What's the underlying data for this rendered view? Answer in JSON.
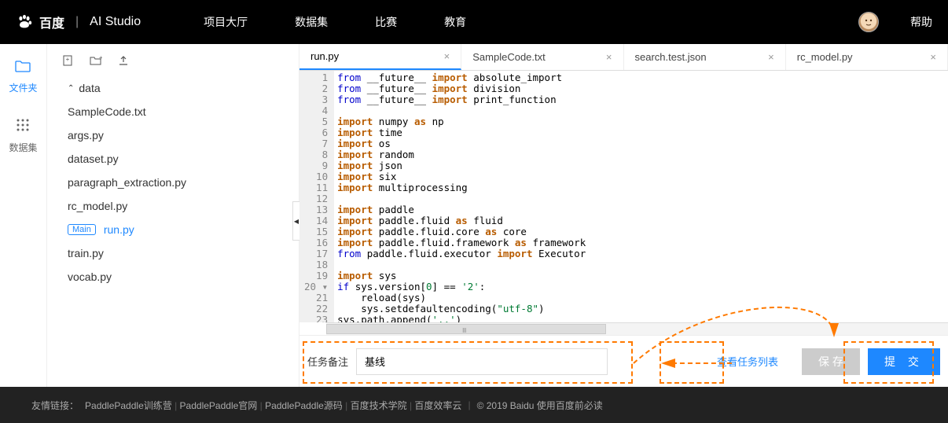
{
  "header": {
    "brand_baidu": "百度",
    "brand_studio": "AI Studio",
    "nav": [
      "项目大厅",
      "数据集",
      "比赛",
      "教育"
    ],
    "help": "帮助"
  },
  "rail": {
    "files_label": "文件夹",
    "datasets_label": "数据集"
  },
  "sidebar": {
    "folder": "data",
    "files": [
      "SampleCode.txt",
      "args.py",
      "dataset.py",
      "paragraph_extraction.py",
      "rc_model.py",
      "run.py",
      "train.py",
      "vocab.py"
    ],
    "main_badge": "Main",
    "active_index": 5
  },
  "tabs": [
    {
      "label": "run.py",
      "active": true
    },
    {
      "label": "SampleCode.txt",
      "active": false
    },
    {
      "label": "search.test.json",
      "active": false
    },
    {
      "label": "rc_model.py",
      "active": false
    }
  ],
  "code": {
    "lines": [
      [
        {
          "t": "kw",
          "v": "from"
        },
        {
          "t": "sp",
          "v": " "
        },
        {
          "t": "mod",
          "v": "__future__"
        },
        {
          "t": "sp",
          "v": " "
        },
        {
          "t": "op",
          "v": "import"
        },
        {
          "t": "sp",
          "v": " "
        },
        {
          "t": "id",
          "v": "absolute_import"
        }
      ],
      [
        {
          "t": "kw",
          "v": "from"
        },
        {
          "t": "sp",
          "v": " "
        },
        {
          "t": "mod",
          "v": "__future__"
        },
        {
          "t": "sp",
          "v": " "
        },
        {
          "t": "op",
          "v": "import"
        },
        {
          "t": "sp",
          "v": " "
        },
        {
          "t": "id",
          "v": "division"
        }
      ],
      [
        {
          "t": "kw",
          "v": "from"
        },
        {
          "t": "sp",
          "v": " "
        },
        {
          "t": "mod",
          "v": "__future__"
        },
        {
          "t": "sp",
          "v": " "
        },
        {
          "t": "op",
          "v": "import"
        },
        {
          "t": "sp",
          "v": " "
        },
        {
          "t": "id",
          "v": "print_function"
        }
      ],
      [],
      [
        {
          "t": "op",
          "v": "import"
        },
        {
          "t": "sp",
          "v": " "
        },
        {
          "t": "id",
          "v": "numpy"
        },
        {
          "t": "sp",
          "v": " "
        },
        {
          "t": "op",
          "v": "as"
        },
        {
          "t": "sp",
          "v": " "
        },
        {
          "t": "id",
          "v": "np"
        }
      ],
      [
        {
          "t": "op",
          "v": "import"
        },
        {
          "t": "sp",
          "v": " "
        },
        {
          "t": "id",
          "v": "time"
        }
      ],
      [
        {
          "t": "op",
          "v": "import"
        },
        {
          "t": "sp",
          "v": " "
        },
        {
          "t": "id",
          "v": "os"
        }
      ],
      [
        {
          "t": "op",
          "v": "import"
        },
        {
          "t": "sp",
          "v": " "
        },
        {
          "t": "id",
          "v": "random"
        }
      ],
      [
        {
          "t": "op",
          "v": "import"
        },
        {
          "t": "sp",
          "v": " "
        },
        {
          "t": "id",
          "v": "json"
        }
      ],
      [
        {
          "t": "op",
          "v": "import"
        },
        {
          "t": "sp",
          "v": " "
        },
        {
          "t": "id",
          "v": "six"
        }
      ],
      [
        {
          "t": "op",
          "v": "import"
        },
        {
          "t": "sp",
          "v": " "
        },
        {
          "t": "id",
          "v": "multiprocessing"
        }
      ],
      [],
      [
        {
          "t": "op",
          "v": "import"
        },
        {
          "t": "sp",
          "v": " "
        },
        {
          "t": "id",
          "v": "paddle"
        }
      ],
      [
        {
          "t": "op",
          "v": "import"
        },
        {
          "t": "sp",
          "v": " "
        },
        {
          "t": "id",
          "v": "paddle.fluid"
        },
        {
          "t": "sp",
          "v": " "
        },
        {
          "t": "op",
          "v": "as"
        },
        {
          "t": "sp",
          "v": " "
        },
        {
          "t": "id",
          "v": "fluid"
        }
      ],
      [
        {
          "t": "op",
          "v": "import"
        },
        {
          "t": "sp",
          "v": " "
        },
        {
          "t": "id",
          "v": "paddle.fluid.core"
        },
        {
          "t": "sp",
          "v": " "
        },
        {
          "t": "op",
          "v": "as"
        },
        {
          "t": "sp",
          "v": " "
        },
        {
          "t": "id",
          "v": "core"
        }
      ],
      [
        {
          "t": "op",
          "v": "import"
        },
        {
          "t": "sp",
          "v": " "
        },
        {
          "t": "id",
          "v": "paddle.fluid.framework"
        },
        {
          "t": "sp",
          "v": " "
        },
        {
          "t": "op",
          "v": "as"
        },
        {
          "t": "sp",
          "v": " "
        },
        {
          "t": "id",
          "v": "framework"
        }
      ],
      [
        {
          "t": "kw",
          "v": "from"
        },
        {
          "t": "sp",
          "v": " "
        },
        {
          "t": "mod",
          "v": "paddle.fluid.executor"
        },
        {
          "t": "sp",
          "v": " "
        },
        {
          "t": "op",
          "v": "import"
        },
        {
          "t": "sp",
          "v": " "
        },
        {
          "t": "id",
          "v": "Executor"
        }
      ],
      [],
      [
        {
          "t": "op",
          "v": "import"
        },
        {
          "t": "sp",
          "v": " "
        },
        {
          "t": "id",
          "v": "sys"
        }
      ],
      [
        {
          "t": "kw",
          "v": "if"
        },
        {
          "t": "sp",
          "v": " "
        },
        {
          "t": "id",
          "v": "sys.version["
        },
        {
          "t": "num",
          "v": "0"
        },
        {
          "t": "id",
          "v": "]"
        },
        {
          "t": "sp",
          "v": " "
        },
        {
          "t": "id",
          "v": "=="
        },
        {
          "t": "sp",
          "v": " "
        },
        {
          "t": "str",
          "v": "'2'"
        },
        {
          "t": "id",
          "v": ":"
        }
      ],
      [
        {
          "t": "sp",
          "v": "    "
        },
        {
          "t": "id",
          "v": "reload(sys)"
        }
      ],
      [
        {
          "t": "sp",
          "v": "    "
        },
        {
          "t": "id",
          "v": "sys.setdefaultencoding("
        },
        {
          "t": "str",
          "v": "\"utf-8\""
        },
        {
          "t": "id",
          "v": ")"
        }
      ],
      [
        {
          "t": "id",
          "v": "sys.path.append("
        },
        {
          "t": "str",
          "v": "'..'"
        },
        {
          "t": "id",
          "v": ")"
        }
      ],
      []
    ],
    "fold_line": 20
  },
  "bottom": {
    "task_label": "任务备注",
    "task_value": "基线",
    "view_tasks": "查看任务列表",
    "save_label": "保 存",
    "submit_label": "提 交"
  },
  "footer": {
    "prefix": "友情链接：",
    "links": [
      "PaddlePaddle训练营",
      "PaddlePaddle官网",
      "PaddlePaddle源码",
      "百度技术学院",
      "百度效率云"
    ],
    "copyright": "© 2019 Baidu 使用百度前必读"
  }
}
